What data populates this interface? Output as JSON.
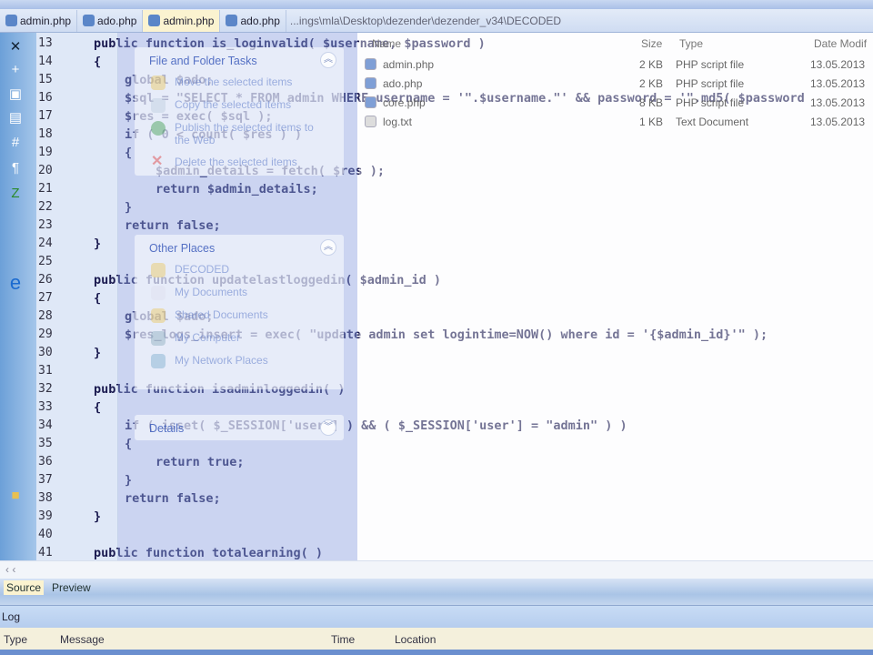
{
  "tabs": [
    {
      "label": "admin.php"
    },
    {
      "label": "ado.php"
    },
    {
      "label": "admin.php",
      "active": true
    },
    {
      "label": "ado.php"
    }
  ],
  "path": "...ings\\mla\\Desktop\\dezender\\dezender_v34\\DECODED",
  "code": {
    "line_numbers": [
      "13",
      "14",
      "15",
      "16",
      "17",
      "18",
      "19",
      "20",
      "21",
      "22",
      "23",
      "24",
      "25",
      "26",
      "27",
      "28",
      "29",
      "30",
      "31",
      "32",
      "33",
      "34",
      "35",
      "36",
      "37",
      "38",
      "39",
      "40",
      "41"
    ],
    "lines": [
      {
        "indent": 0,
        "text": "public function is_loginvalid( $username, $password )"
      },
      {
        "indent": 0,
        "text": "{"
      },
      {
        "indent": 1,
        "text": "global $ado;"
      },
      {
        "indent": 1,
        "text": "$sql = \"SELECT * FROM admin WHERE username = '\".$username.\"' && password = '\".md5( $password"
      },
      {
        "indent": 1,
        "text": "$res = exec( $sql );"
      },
      {
        "indent": 1,
        "text": "if ( 0 < count( $res ) )"
      },
      {
        "indent": 1,
        "text": "{"
      },
      {
        "indent": 2,
        "text": "$admin_details = fetch( $res );"
      },
      {
        "indent": 2,
        "text": "return $admin_details;"
      },
      {
        "indent": 1,
        "text": "}"
      },
      {
        "indent": 1,
        "text": "return false;"
      },
      {
        "indent": 0,
        "text": "}"
      },
      {
        "indent": 0,
        "text": ""
      },
      {
        "indent": 0,
        "text": "public function updatelastloggedin( $admin_id )"
      },
      {
        "indent": 0,
        "text": "{"
      },
      {
        "indent": 1,
        "text": "global $ado;"
      },
      {
        "indent": 1,
        "text": "$res_logs_insert = exec( \"update admin set logintime=NOW() where id = '{$admin_id}'\" );"
      },
      {
        "indent": 0,
        "text": "}"
      },
      {
        "indent": 0,
        "text": ""
      },
      {
        "indent": 0,
        "text": "public function isadminloggedin( )"
      },
      {
        "indent": 0,
        "text": "{"
      },
      {
        "indent": 1,
        "text": "if ( isset( $_SESSION['user'] ) && ( $_SESSION['user'] = \"admin\" ) )"
      },
      {
        "indent": 1,
        "text": "{"
      },
      {
        "indent": 2,
        "text": "return true;"
      },
      {
        "indent": 1,
        "text": "}"
      },
      {
        "indent": 1,
        "text": "return false;"
      },
      {
        "indent": 0,
        "text": "}"
      },
      {
        "indent": 0,
        "text": ""
      },
      {
        "indent": 0,
        "text": "public function totalearning( )"
      }
    ]
  },
  "taskpane": {
    "file_tasks": {
      "title": "File and Folder Tasks",
      "items": [
        "Move the selected items",
        "Copy the selected items",
        "Publish the selected items to the Web",
        "Delete the selected items"
      ]
    },
    "other_places": {
      "title": "Other Places",
      "items": [
        "DECODED",
        "My Documents",
        "Shared Documents",
        "My Computer",
        "My Network Places"
      ]
    },
    "details": {
      "title": "Details"
    }
  },
  "files": {
    "headers": {
      "name": "Name",
      "size": "Size",
      "type": "Type",
      "date": "Date Modif"
    },
    "rows": [
      {
        "name": "admin.php",
        "size": "2 KB",
        "type": "PHP script file",
        "date": "13.05.2013"
      },
      {
        "name": "ado.php",
        "size": "2 KB",
        "type": "PHP script file",
        "date": "13.05.2013"
      },
      {
        "name": "core.php",
        "size": "8 KB",
        "type": "PHP script file",
        "date": "13.05.2013"
      },
      {
        "name": "log.txt",
        "size": "1 KB",
        "type": "Text Document",
        "date": "13.05.2013"
      }
    ]
  },
  "view_tabs": {
    "source": "Source",
    "preview": "Preview"
  },
  "log": {
    "title": "Log",
    "columns": {
      "type": "Type",
      "message": "Message",
      "time": "Time",
      "location": "Location"
    }
  }
}
